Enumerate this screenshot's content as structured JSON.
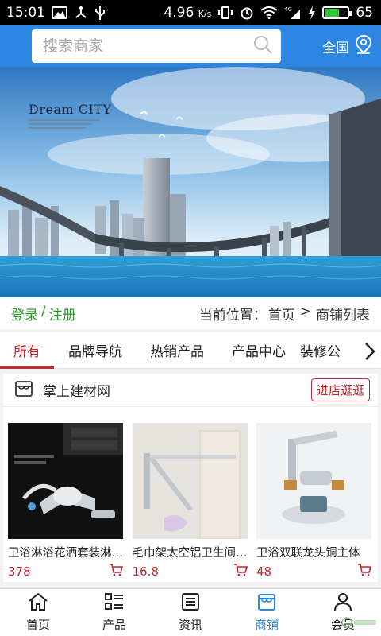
{
  "status_bar": {
    "time": "15:01",
    "network_speed": "4.96",
    "speed_unit": "K/s",
    "battery_level": "65",
    "battery_fill": 0.65,
    "signal_label": "4G"
  },
  "header": {
    "search_placeholder": "搜索商家",
    "region_label": "全国"
  },
  "banner": {
    "title": "Dream CITY"
  },
  "location_bar": {
    "login": "登录",
    "separator": "/",
    "register": "注册",
    "location_prefix": "当前位置：",
    "home": "首页",
    "arrow": ">",
    "current": "商铺列表"
  },
  "tabs": [
    {
      "label": "所有",
      "active": true
    },
    {
      "label": "品牌导航",
      "active": false
    },
    {
      "label": "热销产品",
      "active": false
    },
    {
      "label": "产品中心",
      "active": false
    },
    {
      "label": "装修公",
      "active": false
    }
  ],
  "shop": {
    "name": "掌上建材网",
    "enter_label": "进店逛逛",
    "products": [
      {
        "name": "卫浴淋浴花洒套装淋浴器",
        "price": "378"
      },
      {
        "name": "毛巾架太空铝卫生间置物架",
        "price": "16.8"
      },
      {
        "name": "卫浴双联龙头铜主体",
        "price": "48"
      }
    ]
  },
  "bottom_nav": [
    {
      "label": "首页",
      "icon": "home-icon",
      "active": false
    },
    {
      "label": "产品",
      "icon": "grid-list-icon",
      "active": false
    },
    {
      "label": "资讯",
      "icon": "news-icon",
      "active": false
    },
    {
      "label": "商铺",
      "icon": "shop-icon",
      "active": true
    },
    {
      "label": "会员",
      "icon": "user-icon",
      "active": false
    }
  ],
  "colors": {
    "header_blue": "#2d87e2",
    "accent_red": "#c6262c",
    "auth_green": "#2a9a2a"
  }
}
